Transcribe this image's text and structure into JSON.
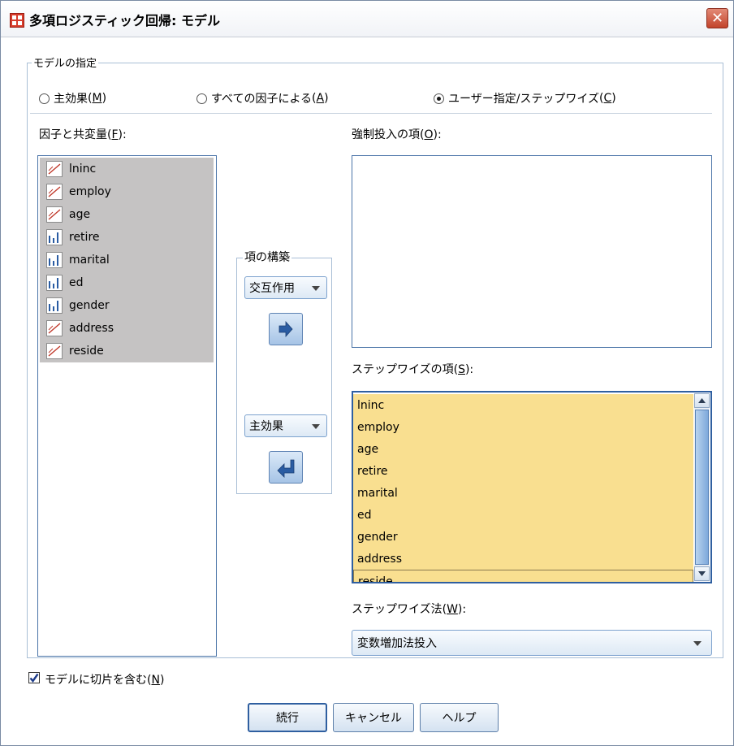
{
  "window": {
    "title": "多項ロジスティック回帰: モデル",
    "close_glyph": "✕"
  },
  "model_spec": {
    "legend": "モデルの指定",
    "options": [
      {
        "label": "主効果",
        "mnemonic": "M",
        "selected": false
      },
      {
        "label": "すべての因子による",
        "mnemonic": "A",
        "selected": false
      },
      {
        "label": "ユーザー指定/ステップワイズ",
        "mnemonic": "C",
        "selected": true
      }
    ]
  },
  "factors": {
    "label": "因子と共変量",
    "mnemonic": "F",
    "items": [
      {
        "name": "lninc",
        "icon": "scale-icon"
      },
      {
        "name": "employ",
        "icon": "scale-icon"
      },
      {
        "name": "age",
        "icon": "scale-icon"
      },
      {
        "name": "retire",
        "icon": "nominal-icon"
      },
      {
        "name": "marital",
        "icon": "nominal-icon"
      },
      {
        "name": "ed",
        "icon": "nominal-icon"
      },
      {
        "name": "gender",
        "icon": "nominal-icon"
      },
      {
        "name": "address",
        "icon": "scale-icon"
      },
      {
        "name": "reside",
        "icon": "scale-icon"
      }
    ]
  },
  "build_terms": {
    "legend": "項の構築",
    "type1": "交互作用",
    "type2": "主効果"
  },
  "forced": {
    "label": "強制投入の項",
    "mnemonic": "O"
  },
  "stepwise": {
    "label": "ステップワイズの項",
    "mnemonic": "S",
    "items": [
      "lninc",
      "employ",
      "age",
      "retire",
      "marital",
      "ed",
      "gender",
      "address",
      "reside"
    ]
  },
  "stepwise_method": {
    "label": "ステップワイズ法",
    "mnemonic": "W",
    "value": "変数増加法投入"
  },
  "intercept": {
    "label": "モデルに切片を含む",
    "mnemonic": "N",
    "checked": true
  },
  "buttons": {
    "continue": "続行",
    "cancel": "キャンセル",
    "help": "ヘルプ"
  },
  "colors": {
    "selection": "#f9df90",
    "factor_bg": "#c5c3c3",
    "close": "#c2432b"
  }
}
